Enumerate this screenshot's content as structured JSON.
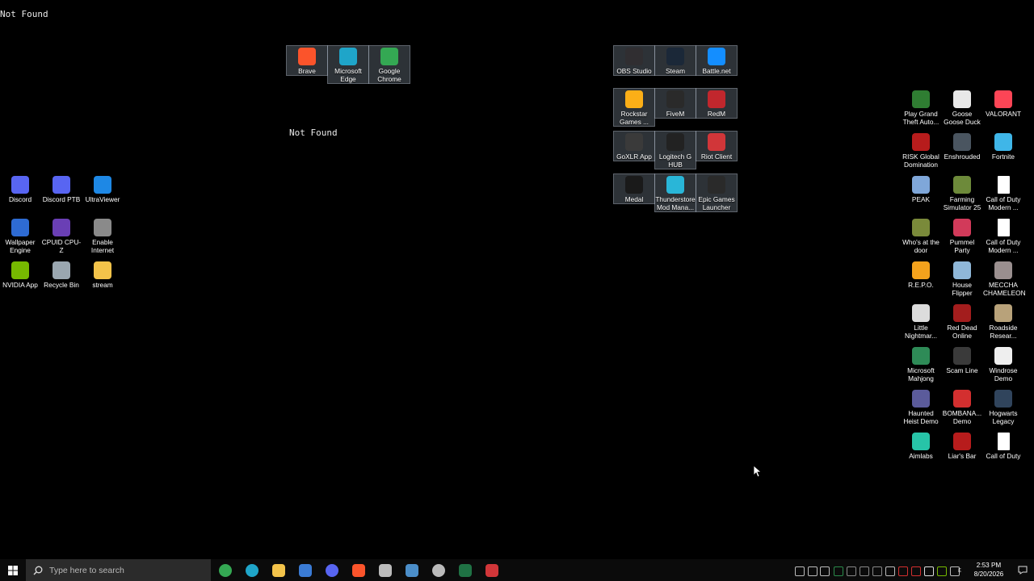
{
  "page_title": "Not Found",
  "center_message": "Not Found",
  "colors": {
    "background": "#000000",
    "taskbar": "#0b0b0b",
    "search_box": "#2b2b2b"
  },
  "left_icons": [
    {
      "label": "Discord",
      "icon": "discord-icon",
      "color": "#5865f2"
    },
    {
      "label": "Discord PTB",
      "icon": "discord-ptb-icon",
      "color": "#5865f2"
    },
    {
      "label": "UltraViewer",
      "icon": "ultraviewer-icon",
      "color": "#1e88e5"
    },
    {
      "label": "Wallpaper Engine",
      "icon": "wallpaper-engine-icon",
      "color": "#2e6bd3"
    },
    {
      "label": "CPUID CPU-Z",
      "icon": "cpuz-icon",
      "color": "#6a3fb5"
    },
    {
      "label": "Enable Internet",
      "icon": "enable-internet-icon",
      "color": "#8a8a8a"
    },
    {
      "label": "NVIDIA App",
      "icon": "nvidia-icon",
      "color": "#76b900"
    },
    {
      "label": "Recycle Bin",
      "icon": "recycle-bin-icon",
      "color": "#9aa7b0"
    },
    {
      "label": "stream",
      "icon": "folder-icon",
      "color": "#f3c34a"
    }
  ],
  "browser_group": [
    {
      "label": "Brave",
      "icon": "brave-icon",
      "color": "#fb542b"
    },
    {
      "label": "Microsoft Edge",
      "icon": "edge-icon",
      "color": "#1fa5c9"
    },
    {
      "label": "Google Chrome",
      "icon": "chrome-icon",
      "color": "#34a853"
    }
  ],
  "launcher_groups": [
    [
      {
        "label": "OBS Studio",
        "icon": "obs-icon",
        "color": "#302e31"
      },
      {
        "label": "Steam",
        "icon": "steam-icon",
        "color": "#1b2838"
      },
      {
        "label": "Battle.net",
        "icon": "battlenet-icon",
        "color": "#148eff"
      }
    ],
    [
      {
        "label": "Rockstar Games ...",
        "icon": "rockstar-icon",
        "color": "#fcaf17"
      },
      {
        "label": "FiveM",
        "icon": "fivem-icon",
        "color": "#2a2a2a"
      },
      {
        "label": "RedM",
        "icon": "redm-icon",
        "color": "#c1272d"
      }
    ],
    [
      {
        "label": "GoXLR App",
        "icon": "goxlr-icon",
        "color": "#3a3a3a"
      },
      {
        "label": "Logitech G HUB",
        "icon": "logitech-icon",
        "color": "#222222"
      },
      {
        "label": "Riot Client",
        "icon": "riot-icon",
        "color": "#d13639"
      }
    ],
    [
      {
        "label": "Medal",
        "icon": "medal-icon",
        "color": "#1a1a1a"
      },
      {
        "label": "Thunderstore Mod Mana...",
        "icon": "thunderstore-icon",
        "color": "#29b6d8"
      },
      {
        "label": "Epic Games Launcher",
        "icon": "epic-games-icon",
        "color": "#2a2a2a"
      }
    ]
  ],
  "right_icons": [
    {
      "label": "Play Grand Theft Auto...",
      "icon": "gta-icon",
      "color": "#2f7d32"
    },
    {
      "label": "Goose Goose Duck",
      "icon": "goose-icon",
      "color": "#e8e8e8"
    },
    {
      "label": "VALORANT",
      "icon": "valorant-icon",
      "color": "#fd4556"
    },
    {
      "label": "RISK Global Domination",
      "icon": "risk-icon",
      "color": "#b71c1c"
    },
    {
      "label": "Enshrouded",
      "icon": "enshrouded-icon",
      "color": "#4a5560"
    },
    {
      "label": "Fortnite",
      "icon": "fortnite-icon",
      "color": "#3fb6e8"
    },
    {
      "label": "PEAK",
      "icon": "peak-icon",
      "color": "#7fa7d9"
    },
    {
      "label": "Farming Simulator 25",
      "icon": "farming-icon",
      "color": "#6d8a3a"
    },
    {
      "label": "Call of Duty Modern ...",
      "icon": "file-icon",
      "color": "#ffffff"
    },
    {
      "label": "Who's at the door",
      "icon": "whos-at-door-icon",
      "color": "#7a8a3a"
    },
    {
      "label": "Pummel Party",
      "icon": "pummel-party-icon",
      "color": "#d23a5a"
    },
    {
      "label": "Call of Duty Modern ...",
      "icon": "file-icon",
      "color": "#ffffff"
    },
    {
      "label": "R.E.P.O.",
      "icon": "repo-icon",
      "color": "#f4a21c"
    },
    {
      "label": "House Flipper",
      "icon": "house-flipper-icon",
      "color": "#8fb7d8"
    },
    {
      "label": "MECCHA CHAMELEON",
      "icon": "meccha-icon",
      "color": "#9a8f8f"
    },
    {
      "label": "Little Nightmar...",
      "icon": "little-nightmares-icon",
      "color": "#dcdcdc"
    },
    {
      "label": "Red Dead Online",
      "icon": "rdo-icon",
      "color": "#a31d1d"
    },
    {
      "label": "Roadside Resear...",
      "icon": "roadside-icon",
      "color": "#b8a27a"
    },
    {
      "label": "Microsoft Mahjong",
      "icon": "mahjong-icon",
      "color": "#2e8b57"
    },
    {
      "label": "Scam Line",
      "icon": "scam-line-icon",
      "color": "#3a3a3a"
    },
    {
      "label": "Windrose Demo",
      "icon": "windrose-icon",
      "color": "#eeeeee"
    },
    {
      "label": "Haunted Heist Demo",
      "icon": "haunted-heist-icon",
      "color": "#5b5b9b"
    },
    {
      "label": "BOMBANA... Demo",
      "icon": "bombana-icon",
      "color": "#d32f2f"
    },
    {
      "label": "Hogwarts Legacy",
      "icon": "hogwarts-icon",
      "color": "#30445c"
    },
    {
      "label": "Aimlabs",
      "icon": "aimlabs-icon",
      "color": "#27c4a8"
    },
    {
      "label": "Liar's Bar",
      "icon": "liars-bar-icon",
      "color": "#b71c1c"
    },
    {
      "label": "Call of Duty",
      "icon": "file-icon",
      "color": "#ffffff"
    }
  ],
  "taskbar": {
    "search_placeholder": "Type here to search",
    "pinned": [
      {
        "name": "chrome",
        "color": "#34a853"
      },
      {
        "name": "edge",
        "color": "#1fa5c9"
      },
      {
        "name": "file-explorer",
        "color": "#f3c34a"
      },
      {
        "name": "microsoft-store",
        "color": "#3a7bd5"
      },
      {
        "name": "discord-ptb",
        "color": "#5865f2"
      },
      {
        "name": "brave",
        "color": "#fb542b"
      },
      {
        "name": "unknown-app",
        "color": "#bbbbbb"
      },
      {
        "name": "steam",
        "color": "#4b8ec9"
      },
      {
        "name": "obs-studio",
        "color": "#bbbbbb"
      },
      {
        "name": "excel",
        "color": "#1f7244"
      },
      {
        "name": "riot-client",
        "color": "#d13639"
      }
    ],
    "clock_time": "2:53 PM",
    "clock_date": "8/20/2026",
    "input_indicator": "ε"
  }
}
